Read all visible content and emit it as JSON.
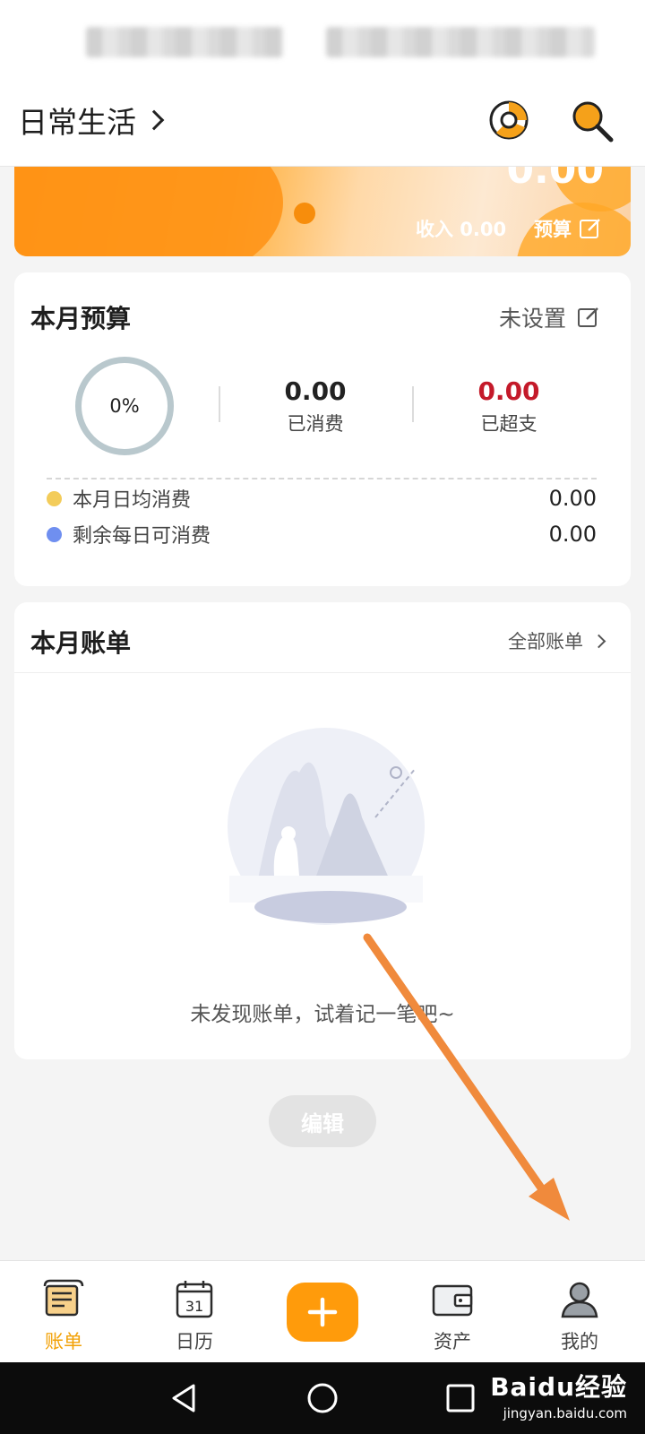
{
  "header": {
    "title": "日常生活"
  },
  "banner": {
    "amount": "0.00",
    "income_label": "收入 0.00",
    "budget_label": "预算"
  },
  "budget": {
    "title": "本月预算",
    "status": "未设置",
    "percent": "0%",
    "spent_value": "0.00",
    "spent_label": "已消费",
    "over_value": "0.00",
    "over_label": "已超支",
    "rows": [
      {
        "label": "本月日均消费",
        "value": "0.00",
        "dot_color": "#f3cc5a"
      },
      {
        "label": "剩余每日可消费",
        "value": "0.00",
        "dot_color": "#6f8ff0"
      }
    ]
  },
  "bills": {
    "title": "本月账单",
    "all_link": "全部账单",
    "empty_text": "未发现账单，试着记一笔吧~"
  },
  "edit_button": "编辑",
  "tabs": [
    {
      "label": "账单",
      "icon": "bill-scroll-icon",
      "active": true
    },
    {
      "label": "日历",
      "icon": "calendar-icon",
      "day": "31"
    },
    {
      "label": "",
      "icon": "plus-icon"
    },
    {
      "label": "资产",
      "icon": "wallet-icon"
    },
    {
      "label": "我的",
      "icon": "profile-icon"
    }
  ],
  "colors": {
    "accent": "#ff9b0b",
    "over_red": "#c41a2a",
    "active_tab": "#f2a107",
    "annotation_arrow": "#f08a3c"
  },
  "watermark": {
    "main": "Baidu经验",
    "sub": "jingyan.baidu.com"
  }
}
